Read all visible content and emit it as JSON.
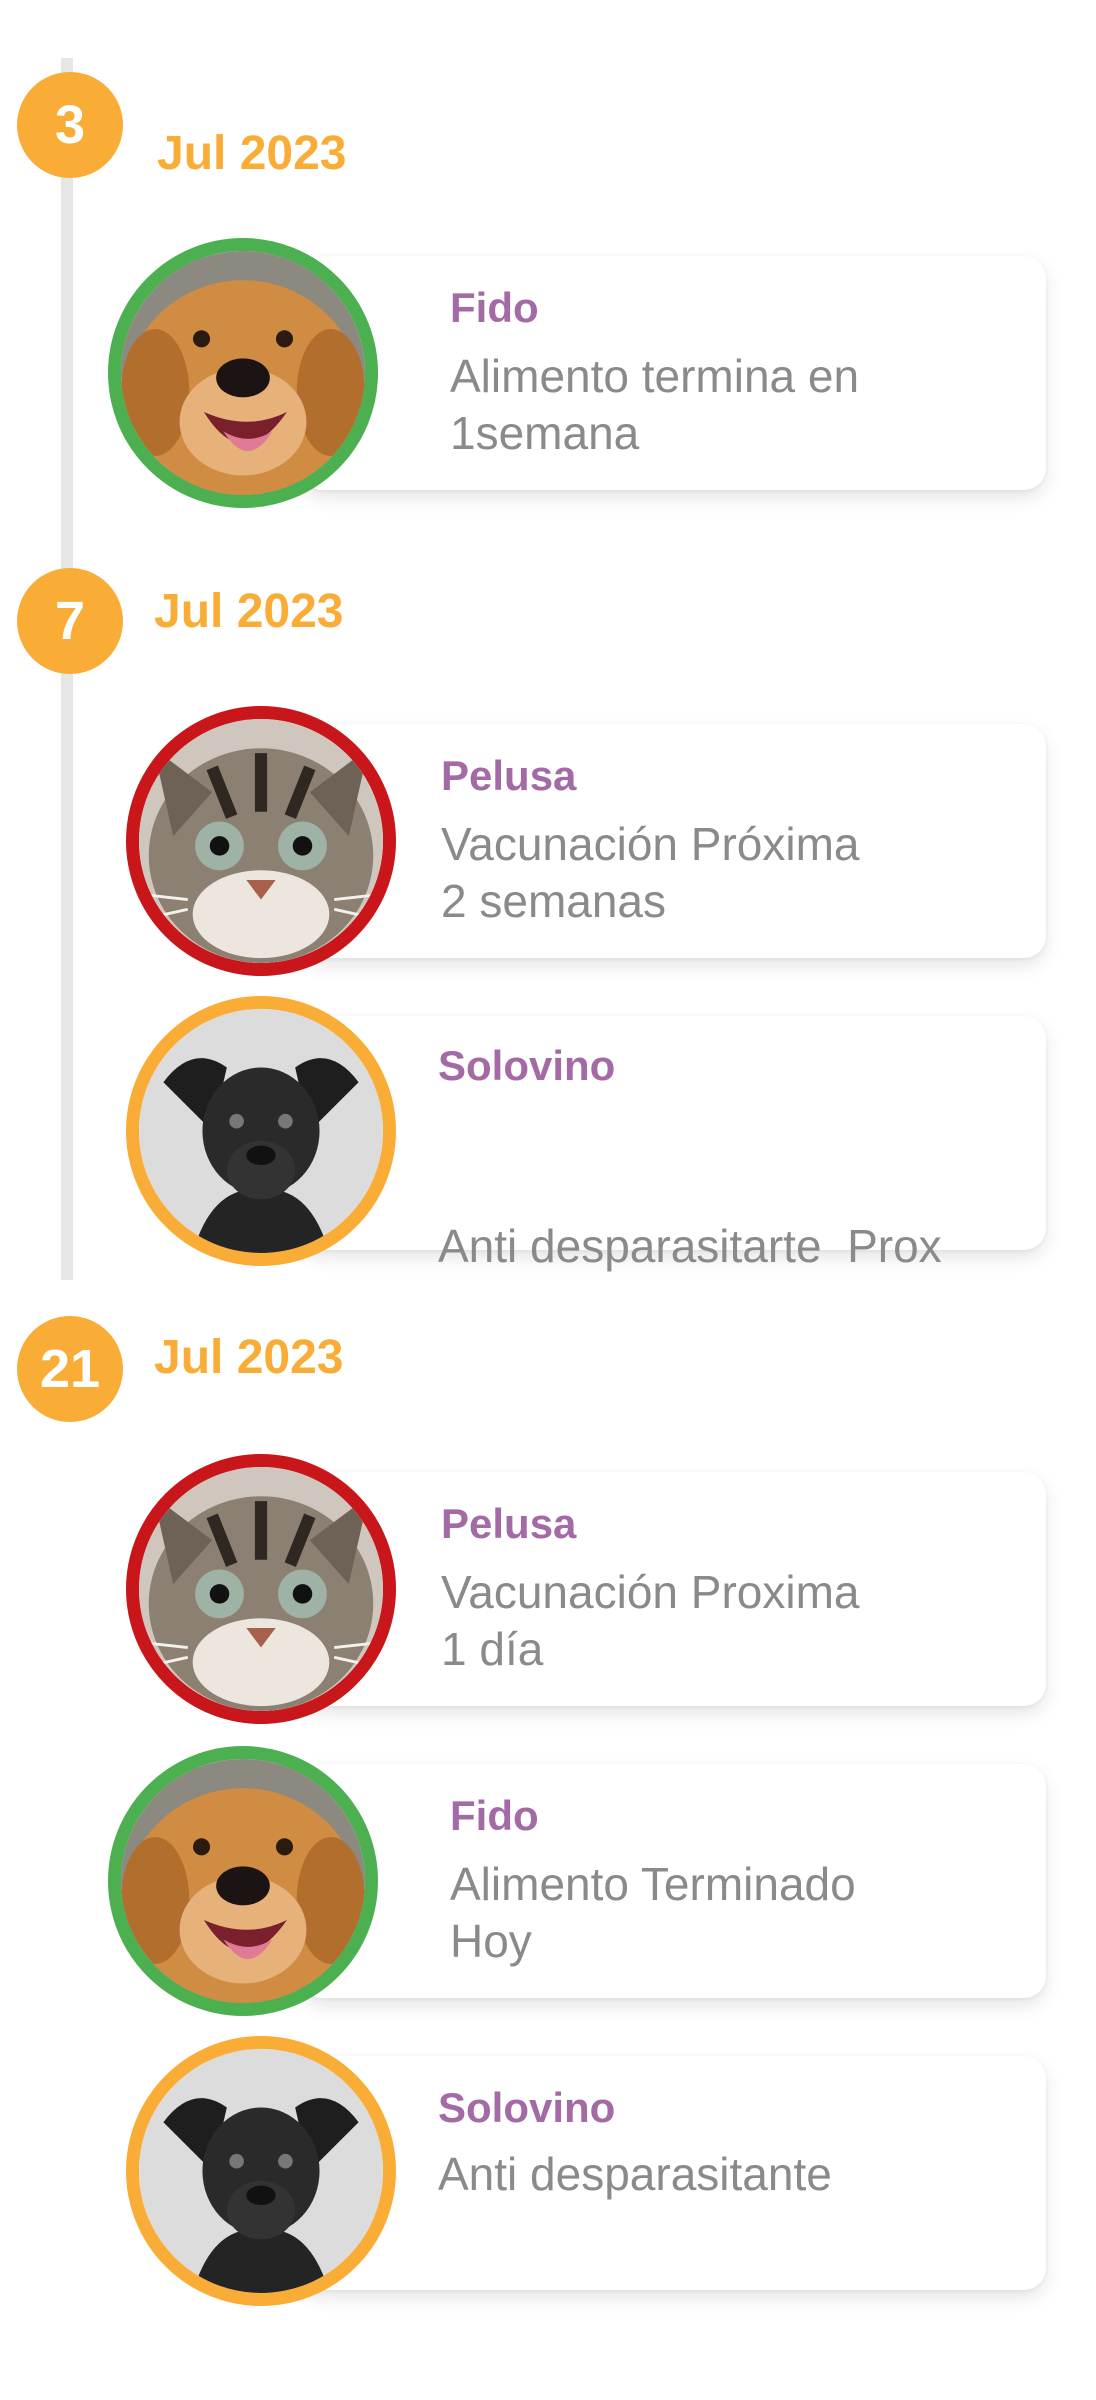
{
  "groups": [
    {
      "day": "3",
      "date": "Jul 2023",
      "events": [
        {
          "pet": "Fido",
          "line1": "Alimento termina en",
          "line2": "1semana",
          "ring_color": "#4caf50",
          "avatar": "golden-dog-avatar"
        }
      ]
    },
    {
      "day": "7",
      "date": "Jul 2023",
      "events": [
        {
          "pet": "Pelusa",
          "line1": "Vacunación Próxima",
          "line2": "2 semanas",
          "ring_color": "#c8161a",
          "avatar": "tabby-cat-avatar"
        },
        {
          "pet": "Solovino",
          "line1": "Anti desparasitarte  Prox",
          "line2": "",
          "ring_color": "#f9ad37",
          "avatar": "black-dog-avatar"
        }
      ]
    },
    {
      "day": "21",
      "date": "Jul 2023",
      "events": [
        {
          "pet": "Pelusa",
          "line1": "Vacunación Proxima",
          "line2": "1 día",
          "ring_color": "#c8161a",
          "avatar": "tabby-cat-avatar"
        },
        {
          "pet": "Fido",
          "line1": "Alimento Terminado",
          "line2": "Hoy",
          "ring_color": "#4caf50",
          "avatar": "golden-dog-avatar"
        },
        {
          "pet": "Solovino",
          "line1": "Anti desparasitante",
          "line2": "",
          "ring_color": "#f9ad37",
          "avatar": "black-dog-avatar"
        }
      ]
    }
  ],
  "colors": {
    "accent": "#f9ad37",
    "pet_name": "#a46aa6",
    "text": "#8a8a8a",
    "line": "#e6e6e6"
  }
}
